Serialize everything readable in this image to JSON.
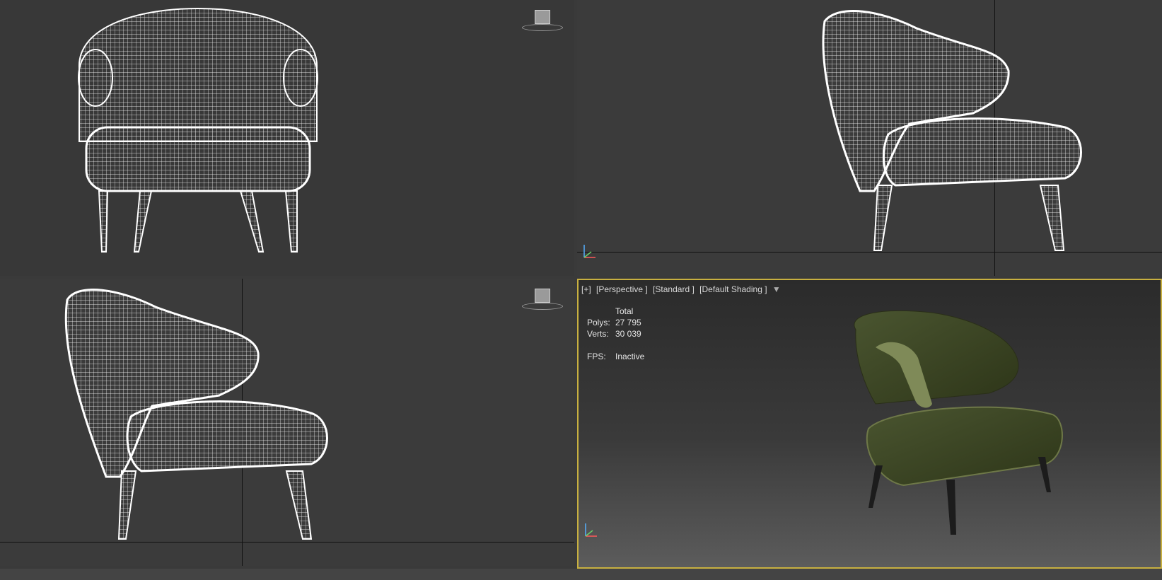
{
  "viewports": {
    "perspective": {
      "label_parts": [
        "[+]",
        "[Perspective ]",
        "[Standard ]",
        "[Default Shading ]"
      ],
      "stats_header": "Total",
      "polys_label": "Polys:",
      "polys_value": "27 795",
      "verts_label": "Verts:",
      "verts_value": "30 039",
      "fps_label": "FPS:",
      "fps_value": "Inactive"
    }
  },
  "colors": {
    "wireframe": "#ffffff",
    "active_border": "#c8b040",
    "chair_fabric": "#3d4722",
    "chair_leg": "#1c1c1c"
  },
  "icons": [
    "viewcube-icon",
    "filter-icon",
    "axis-gizmo-icon"
  ]
}
